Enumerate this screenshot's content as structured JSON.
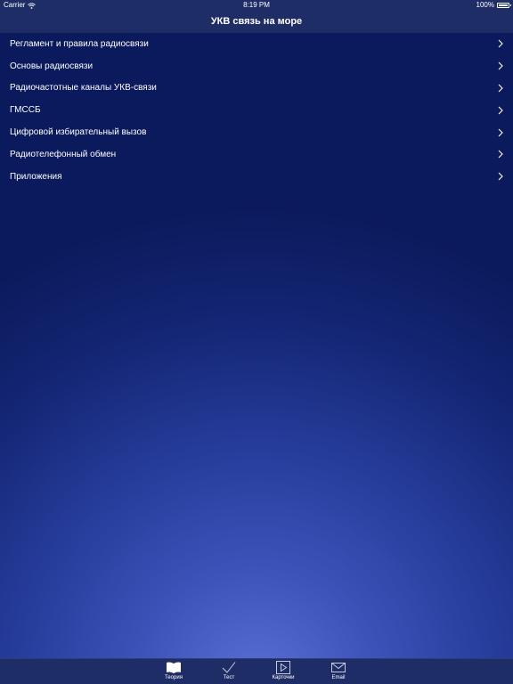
{
  "status_bar": {
    "carrier": "Carrier",
    "time": "8:19 PM",
    "battery": "100%"
  },
  "nav": {
    "title": "УКВ связь на море"
  },
  "menu": {
    "items": [
      {
        "label": "Регламент и правила радиосвязи"
      },
      {
        "label": "Основы радиосвязи"
      },
      {
        "label": "Радиочастотные каналы УКВ-связи"
      },
      {
        "label": "ГМССБ"
      },
      {
        "label": "Цифровой избирательный вызов"
      },
      {
        "label": "Радиотелефонный обмен"
      },
      {
        "label": "Приложения"
      }
    ]
  },
  "tab_bar": {
    "tabs": [
      {
        "label": "Теория",
        "icon": "book-icon",
        "selected": true
      },
      {
        "label": "Тест",
        "icon": "checkmark-icon",
        "selected": false
      },
      {
        "label": "Карточки",
        "icon": "play-icon",
        "selected": false
      },
      {
        "label": "Email",
        "icon": "envelope-icon",
        "selected": false
      }
    ]
  },
  "colors": {
    "bar_background": "#1f2d66",
    "gradient_center": "#5a6fd6",
    "gradient_edge": "#0b1a5c",
    "text": "#ffffff",
    "tab_selected": "#ffffff",
    "tab_unselected": "#c8cbe0"
  }
}
